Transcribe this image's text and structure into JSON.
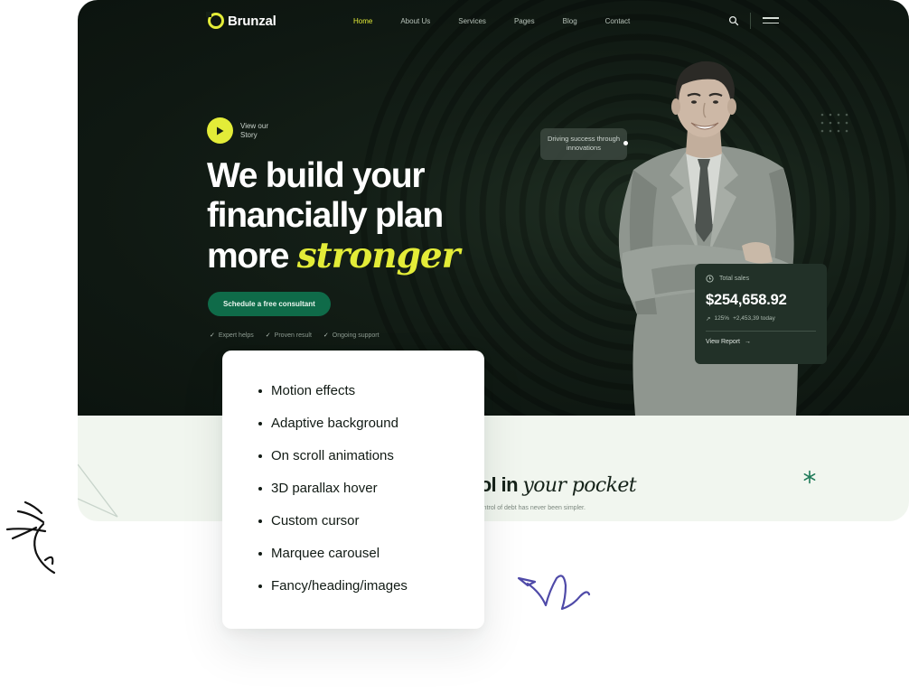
{
  "nav": {
    "brand": "Brunzal",
    "items": [
      {
        "label": "Home",
        "active": true
      },
      {
        "label": "About Us",
        "active": false
      },
      {
        "label": "Services",
        "active": false
      },
      {
        "label": "Pages",
        "active": false
      },
      {
        "label": "Blog",
        "active": false
      },
      {
        "label": "Contact",
        "active": false
      }
    ]
  },
  "hero": {
    "story_label": "View our Story",
    "headline_line1": "We build your",
    "headline_line2": "financially plan",
    "headline_line3_plain": "more",
    "headline_line3_accent": "stronger",
    "cta_label": "Schedule a free consultant",
    "features": [
      "Expert helps",
      "Proven result",
      "Ongoing support"
    ],
    "tooltip": "Driving success through innovations"
  },
  "sales_card": {
    "label": "Total sales",
    "value": "$254,658.92",
    "delta_pct": "125%",
    "delta_today": "+2,453,39 today",
    "link": "View Report"
  },
  "section": {
    "title_plain": "trol in",
    "title_accent": "your pocket",
    "subtitle": "ing control of debt has never been simpler."
  },
  "feature_list": [
    "Motion effects",
    "Adaptive background",
    "On scroll animations",
    "3D parallax hover",
    "Custom cursor",
    "Marquee carousel",
    "Fancy/heading/images"
  ],
  "colors": {
    "accent": "#e3ec38",
    "hero_bg": "#141f17",
    "cta": "#0f6b49",
    "section_bg": "#f1f6ef",
    "doodle": "#4f4aa8"
  }
}
